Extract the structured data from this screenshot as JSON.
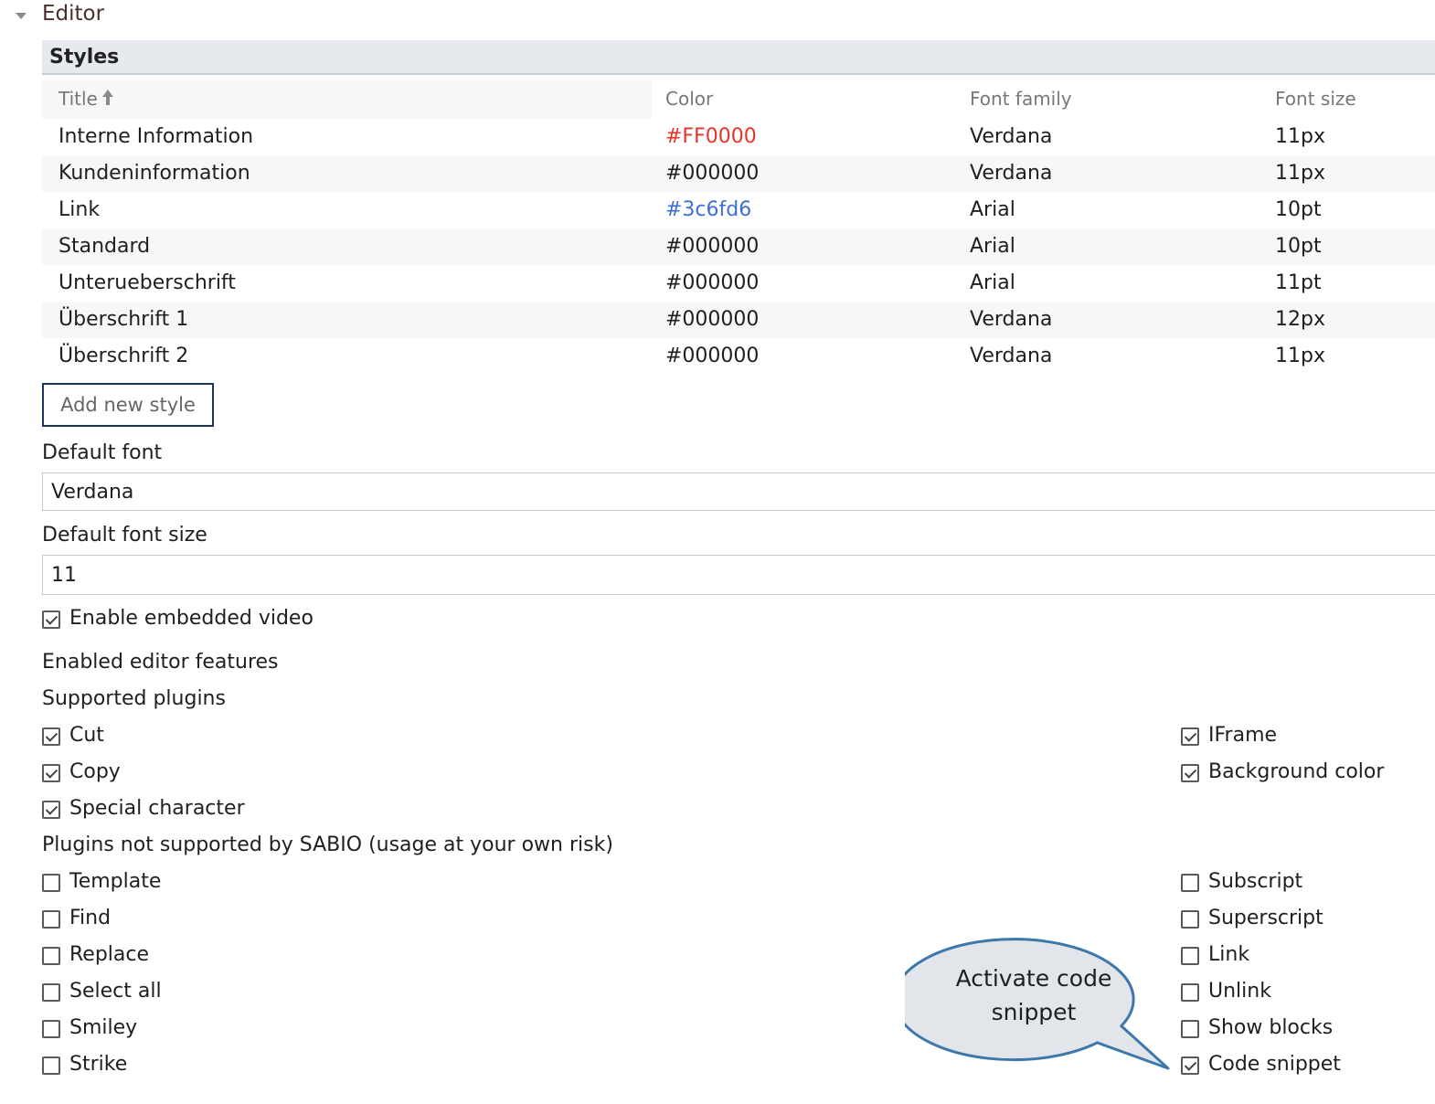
{
  "section": {
    "title": "Editor",
    "caret_icon": "caret-down-icon"
  },
  "styles": {
    "title": "Styles",
    "columns": {
      "title": "Title",
      "color": "Color",
      "font_family": "Font family",
      "font_size": "Font size"
    },
    "sort_icon": "sort-ascending-icon",
    "rows": [
      {
        "title": "Interne Information",
        "color": "#FF0000",
        "color_display": "#e8332a",
        "font_family": "Verdana",
        "font_size": "11px"
      },
      {
        "title": "Kundeninformation",
        "color": "#000000",
        "color_display": "#1f1f1f",
        "font_family": "Verdana",
        "font_size": "11px"
      },
      {
        "title": "Link",
        "color": "#3c6fd6",
        "color_display": "#3c6fd6",
        "font_family": "Arial",
        "font_size": "10pt"
      },
      {
        "title": "Standard",
        "color": "#000000",
        "color_display": "#1f1f1f",
        "font_family": "Arial",
        "font_size": "10pt"
      },
      {
        "title": "Unterueberschrift",
        "color": "#000000",
        "color_display": "#1f1f1f",
        "font_family": "Arial",
        "font_size": "11pt"
      },
      {
        "title": "Überschrift 1",
        "color": "#000000",
        "color_display": "#1f1f1f",
        "font_family": "Verdana",
        "font_size": "12px"
      },
      {
        "title": "Überschrift 2",
        "color": "#000000",
        "color_display": "#1f1f1f",
        "font_family": "Verdana",
        "font_size": "11px"
      }
    ],
    "add_button": "Add new style"
  },
  "default_font": {
    "label": "Default font",
    "value": "Verdana"
  },
  "default_font_size": {
    "label": "Default font size",
    "value": "11"
  },
  "embedded_video": {
    "label": "Enable embedded video",
    "checked": true
  },
  "features": {
    "heading": "Enabled editor features",
    "supported": {
      "heading": "Supported plugins",
      "left": [
        {
          "label": "Cut",
          "checked": true
        },
        {
          "label": "Copy",
          "checked": true
        },
        {
          "label": "Special character",
          "checked": true
        }
      ],
      "right": [
        {
          "label": "IFrame",
          "checked": true
        },
        {
          "label": "Background color",
          "checked": true
        }
      ]
    },
    "unsupported": {
      "heading": "Plugins not supported by SABIO (usage at your own risk)",
      "left": [
        {
          "label": "Template",
          "checked": false
        },
        {
          "label": "Find",
          "checked": false
        },
        {
          "label": "Replace",
          "checked": false
        },
        {
          "label": "Select all",
          "checked": false
        },
        {
          "label": "Smiley",
          "checked": false
        },
        {
          "label": "Strike",
          "checked": false
        }
      ],
      "right": [
        {
          "label": "Subscript",
          "checked": false
        },
        {
          "label": "Superscript",
          "checked": false
        },
        {
          "label": "Link",
          "checked": false
        },
        {
          "label": "Unlink",
          "checked": false
        },
        {
          "label": "Show blocks",
          "checked": false
        },
        {
          "label": "Code snippet",
          "checked": true
        }
      ]
    }
  },
  "callout": {
    "line1": "Activate code",
    "line2": "snippet",
    "fill": "#e2e5ea",
    "stroke": "#3d78ad"
  }
}
